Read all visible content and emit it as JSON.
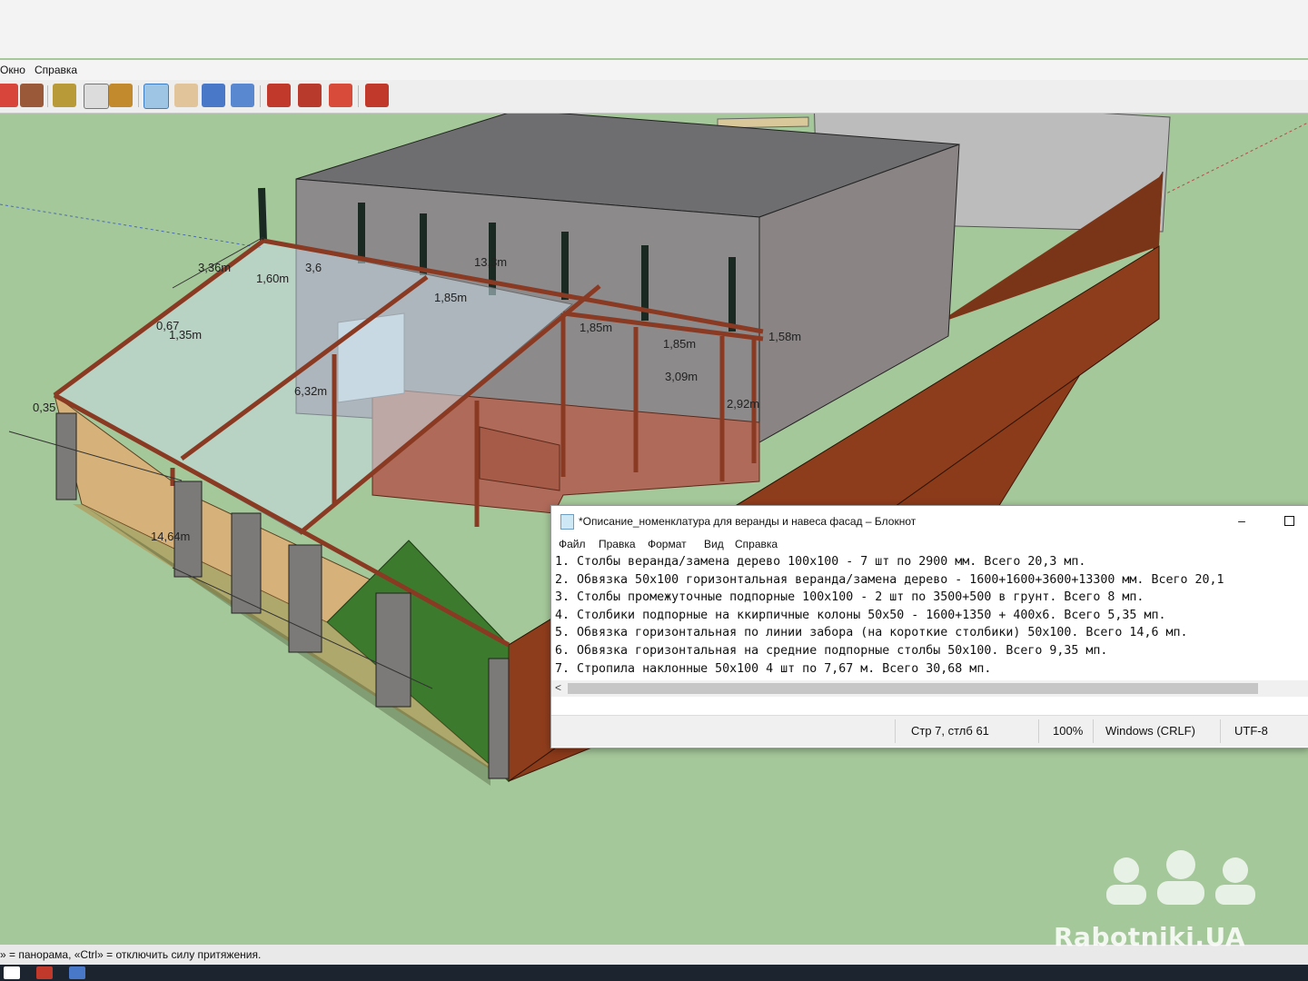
{
  "app": {
    "menubar": [
      "Окно",
      "Справка"
    ],
    "toolbar_icons": [
      "rotate-icon",
      "export-icon",
      "tape-measure-icon",
      "text-icon",
      "paint-bucket-icon",
      "orbit-icon",
      "pan-icon",
      "zoom-icon",
      "zoom-extents-icon",
      "previous-view-icon",
      "next-view-icon",
      "section-icon",
      "warehouse-icon"
    ],
    "status_hint": "» = панорама, «Ctrl» = отключить силу притяжения.",
    "colors": {
      "ground": "#a5c89a",
      "wall_brick": "#8b3a1a",
      "timber": "#8a3a22",
      "glass": "#c9dbe6",
      "grass": "#3a7a2e"
    }
  },
  "model_dimensions": [
    "3,36m",
    "1,60m",
    "3,6",
    "13,3m",
    "1,85m",
    "0,67",
    "1,35m",
    "1,85m",
    "1,85m",
    "1,58m",
    "3,09m",
    "2,92m",
    "0,35",
    "6,32m",
    "14,64m"
  ],
  "notepad": {
    "title": "*Описание_номенклатура для веранды и навеса фасад – Блокнот",
    "menu": [
      "Файл",
      "Правка",
      "Формат",
      "Вид",
      "Справка"
    ],
    "lines": [
      "1. Столбы веранда/замена дерево 100х100 - 7 шт по 2900 мм. Всего 20,3 мп.",
      "2. Обвязка 50х100 горизонтальная веранда/замена дерево - 1600+1600+3600+13300 мм. Всего 20,1",
      "3. Столбы промежуточные подпорные 100х100 - 2 шт по 3500+500 в грунт. Всего 8 мп.",
      "4. Столбики подпорные на ккирпичные колоны 50х50 - 1600+1350 + 400х6. Всего 5,35 мп.",
      "5. Обвязка горизонтальная по линии забора (на короткие столбики) 50х100. Всего 14,6 мп.",
      "6. Обвязка горизонтальная на средние подпорные столбы 50х100. Всего 9,35 мп.",
      "7. Стропила наклонные 50х100 4 шт по 7,67 м. Всего 30,68 мп."
    ],
    "status": {
      "position": "Стр 7, стлб 61",
      "zoom": "100%",
      "line_endings": "Windows (CRLF)",
      "encoding": "UTF-8"
    }
  },
  "watermark": "Rabotniki.UA"
}
